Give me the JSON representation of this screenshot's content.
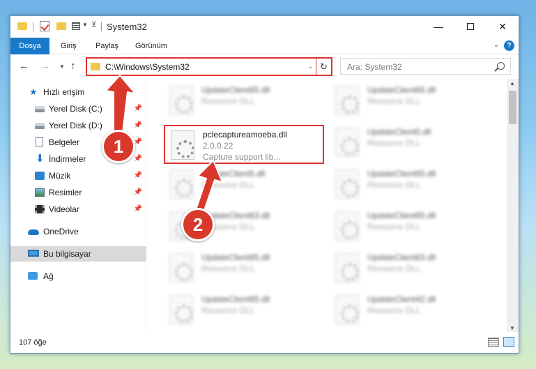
{
  "window": {
    "title": "System32",
    "controls": {
      "minimize": "—",
      "maximize": "",
      "close": "✕"
    }
  },
  "ribbon": {
    "tabs": [
      "Dosya",
      "Giriş",
      "Paylaş",
      "Görünüm"
    ],
    "help": "?"
  },
  "address": {
    "path": "C:\\Windows\\System32",
    "search_placeholder": "Ara: System32"
  },
  "nav_pane": {
    "items": [
      {
        "label": "Hızlı erişim",
        "icon": "star-icon",
        "pinned": false
      },
      {
        "label": "Yerel Disk (C:)",
        "icon": "disk-icon",
        "pinned": true
      },
      {
        "label": "Yerel Disk (D:)",
        "icon": "disk-icon",
        "pinned": true
      },
      {
        "label": "Belgeler",
        "icon": "documents-icon",
        "pinned": true
      },
      {
        "label": "İndirmeler",
        "icon": "downloads-icon",
        "pinned": true
      },
      {
        "label": "Müzik",
        "icon": "music-icon",
        "pinned": true
      },
      {
        "label": "Resimler",
        "icon": "pictures-icon",
        "pinned": true
      },
      {
        "label": "Videolar",
        "icon": "videos-icon",
        "pinned": true
      },
      {
        "label": "OneDrive",
        "icon": "cloud-icon",
        "pinned": false
      },
      {
        "label": "Bu bilgisayar",
        "icon": "computer-icon",
        "pinned": false,
        "selected": true
      },
      {
        "label": "Ağ",
        "icon": "network-icon",
        "pinned": false
      }
    ]
  },
  "files": {
    "left": [
      {
        "name": "UpdateClient65.dll",
        "line2": "Resource DLL",
        "line3": "",
        "blurred": true
      },
      {
        "name": "pclecaptureamoeba.dll",
        "line2": "2.0.0.22",
        "line3": "Capture support lib...",
        "blurred": false,
        "highlighted": true
      },
      {
        "name": "UpdateClient5.dll",
        "line2": "Resource DLL",
        "line3": "",
        "blurred": true
      },
      {
        "name": "UpdateClient63.dll",
        "line2": "Resource DLL",
        "line3": "",
        "blurred": true
      },
      {
        "name": "UpdateClient65.dll",
        "line2": "Resource DLL",
        "line3": "",
        "blurred": true
      },
      {
        "name": "UpdateClient65.dll",
        "line2": "Resource DLL",
        "line3": "",
        "blurred": true
      }
    ],
    "right": [
      {
        "name": "UpdateClient65.dll",
        "line2": "Resource DLL",
        "line3": "",
        "blurred": true
      },
      {
        "name": "UpdateClient5.dll",
        "line2": "Resource DLL",
        "line3": "",
        "blurred": true
      },
      {
        "name": "UpdateClient65.dll",
        "line2": "Resource DLL",
        "line3": "",
        "blurred": true
      },
      {
        "name": "UpdateClient65.dll",
        "line2": "Resource DLL",
        "line3": "",
        "blurred": true
      },
      {
        "name": "UpdateClient63.dll",
        "line2": "Resource DLL",
        "line3": "",
        "blurred": true
      },
      {
        "name": "UpdateClient42.dll",
        "line2": "Resource DLL",
        "line3": "",
        "blurred": true
      }
    ]
  },
  "status": {
    "count": "107 öğe"
  },
  "annotations": {
    "step1": "1",
    "step2": "2",
    "color": "#d9382c"
  }
}
